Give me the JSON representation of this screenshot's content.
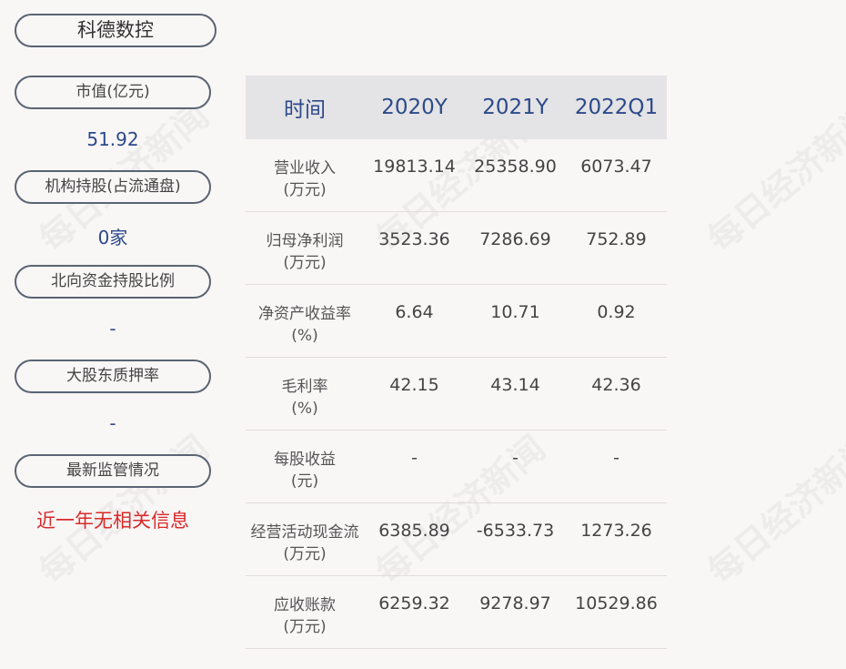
{
  "company_name": "科德数控",
  "sidebar": {
    "items": [
      {
        "label": "市值(亿元)",
        "value": "51.92"
      },
      {
        "label": "机构持股(占流通盘)",
        "value": "0家"
      },
      {
        "label": "北向资金持股比例",
        "value": "-"
      },
      {
        "label": "大股东质押率",
        "value": "-"
      },
      {
        "label": "最新监管情况",
        "value": "近一年无相关信息"
      }
    ]
  },
  "table": {
    "headers": [
      "时间",
      "2020Y",
      "2021Y",
      "2022Q1"
    ],
    "rows": [
      {
        "name": "营业收入",
        "unit": "(万元)",
        "values": [
          "19813.14",
          "25358.90",
          "6073.47"
        ]
      },
      {
        "name": "归母净利润",
        "unit": "(万元)",
        "values": [
          "3523.36",
          "7286.69",
          "752.89"
        ]
      },
      {
        "name": "净资产收益率",
        "unit": "(%)",
        "values": [
          "6.64",
          "10.71",
          "0.92"
        ]
      },
      {
        "name": "毛利率",
        "unit": "(%)",
        "values": [
          "42.15",
          "43.14",
          "42.36"
        ]
      },
      {
        "name": "每股收益",
        "unit": "(元)",
        "values": [
          "-",
          "-",
          "-"
        ]
      },
      {
        "name": "经营活动现金流",
        "unit": "(万元)",
        "values": [
          "6385.89",
          "-6533.73",
          "1273.26"
        ]
      },
      {
        "name": "应收账款",
        "unit": "(万元)",
        "values": [
          "6259.32",
          "9278.97",
          "10529.86"
        ]
      }
    ]
  },
  "watermark": "每日经济新闻",
  "colors": {
    "accent": "#2c4a8a",
    "alert": "#d72b2b",
    "header_bg": "#e4e3e5"
  }
}
